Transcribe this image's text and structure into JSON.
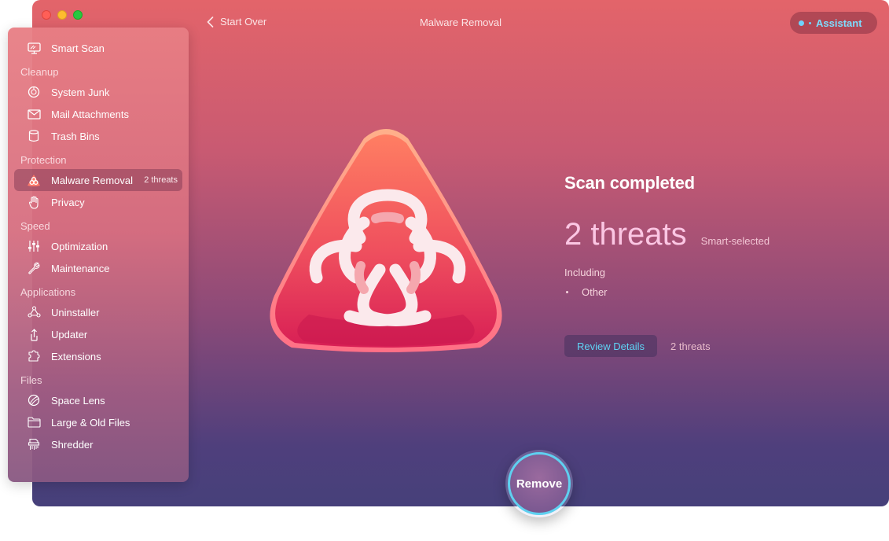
{
  "window": {
    "title": "Malware Removal",
    "back_label": "Start Over",
    "assistant_label": "Assistant"
  },
  "sidebar": {
    "smart_scan": "Smart Scan",
    "sections": [
      {
        "header": "Cleanup",
        "items": [
          {
            "label": "System Junk",
            "icon": "system-junk-icon"
          },
          {
            "label": "Mail Attachments",
            "icon": "mail-icon"
          },
          {
            "label": "Trash Bins",
            "icon": "trash-icon"
          }
        ]
      },
      {
        "header": "Protection",
        "items": [
          {
            "label": "Malware Removal",
            "icon": "biohazard-icon",
            "badge": "2 threats",
            "active": true
          },
          {
            "label": "Privacy",
            "icon": "hand-icon"
          }
        ]
      },
      {
        "header": "Speed",
        "items": [
          {
            "label": "Optimization",
            "icon": "sliders-icon"
          },
          {
            "label": "Maintenance",
            "icon": "wrench-icon"
          }
        ]
      },
      {
        "header": "Applications",
        "items": [
          {
            "label": "Uninstaller",
            "icon": "uninstaller-icon"
          },
          {
            "label": "Updater",
            "icon": "updater-icon"
          },
          {
            "label": "Extensions",
            "icon": "extensions-icon"
          }
        ]
      },
      {
        "header": "Files",
        "items": [
          {
            "label": "Space Lens",
            "icon": "space-lens-icon"
          },
          {
            "label": "Large & Old Files",
            "icon": "folder-icon"
          },
          {
            "label": "Shredder",
            "icon": "shredder-icon"
          }
        ]
      }
    ]
  },
  "result": {
    "title": "Scan completed",
    "threats": "2 threats",
    "smart_selected": "Smart-selected",
    "including": "Including",
    "categories": [
      "Other"
    ],
    "review_label": "Review Details",
    "review_count": "2 threats"
  },
  "actions": {
    "remove_label": "Remove"
  },
  "colors": {
    "accent_cyan": "#5fd0f0",
    "threat_pink": "#fbc6e3"
  }
}
